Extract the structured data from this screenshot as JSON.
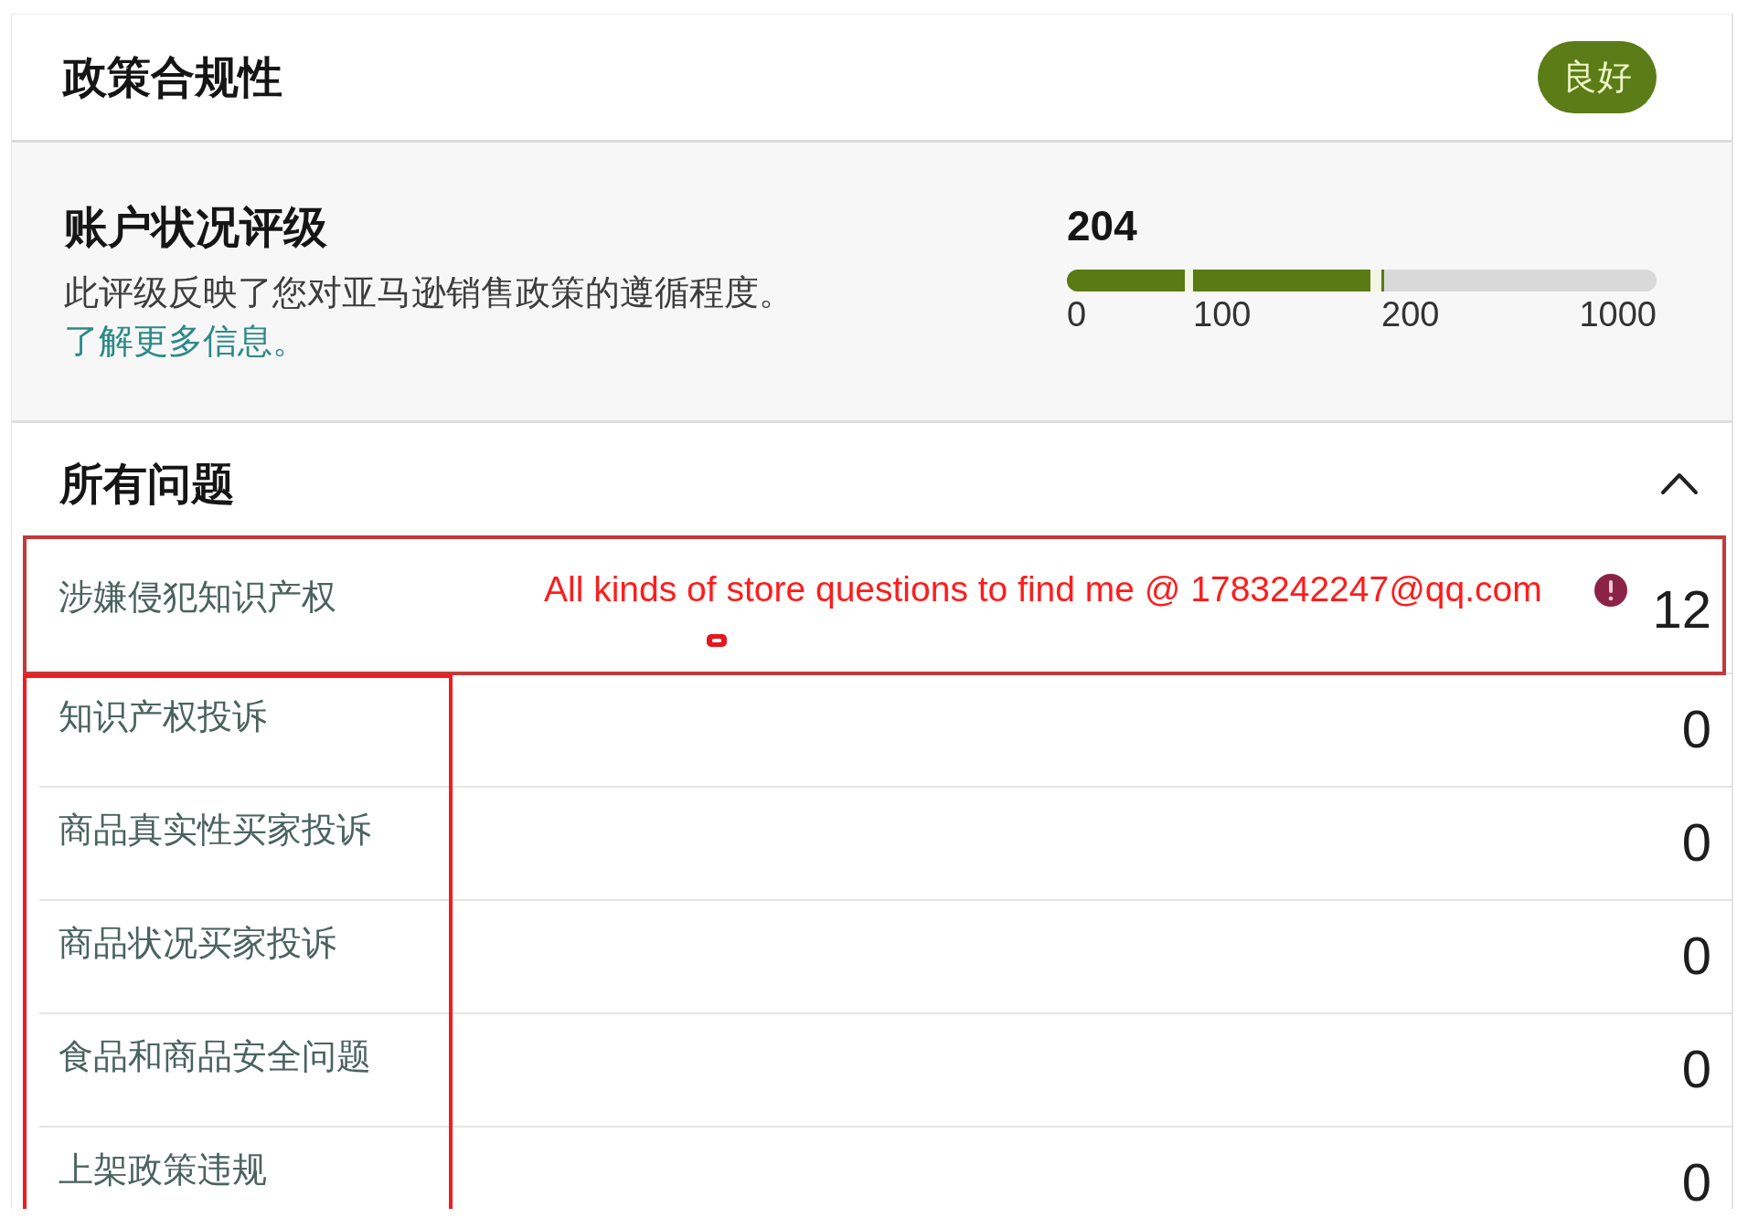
{
  "header": {
    "title": "政策合规性",
    "status": "良好"
  },
  "rating": {
    "title": "账户状况评级",
    "description": "此评级反映了您对亚马逊销售政策的遵循程度。",
    "link": "了解更多信息。",
    "score": "204",
    "meter": {
      "level": 0.538,
      "labels": [
        "0",
        "100",
        "200",
        "1000"
      ]
    }
  },
  "issues": {
    "title": "所有问题",
    "expanded": true,
    "items": [
      {
        "name": "涉嫌侵犯知识产权",
        "count": "12",
        "alert": true
      },
      {
        "name": "知识产权投诉",
        "count": "0",
        "alert": false
      },
      {
        "name": "商品真实性买家投诉",
        "count": "0",
        "alert": false
      },
      {
        "name": "商品状况买家投诉",
        "count": "0",
        "alert": false
      },
      {
        "name": "食品和商品安全问题",
        "count": "0",
        "alert": false
      },
      {
        "name": "上架政策违规",
        "count": "0",
        "alert": false
      }
    ]
  },
  "annotation": {
    "text": "All kinds of store questions to find me @ 1783242247@qq.com"
  }
}
